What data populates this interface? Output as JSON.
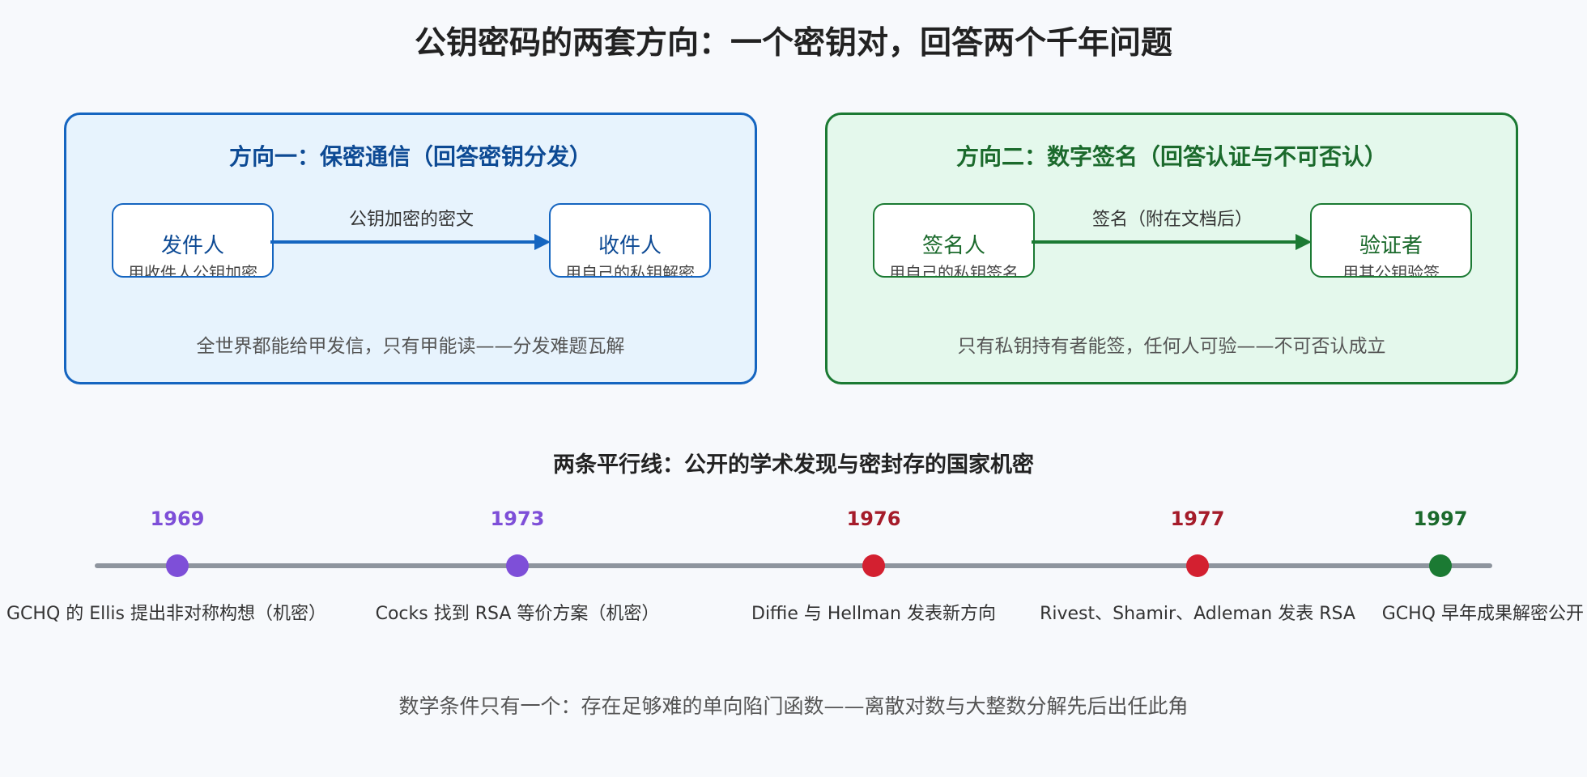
{
  "title": "公钥密码的两套方向：一个密钥对，回答两个千年问题",
  "colors": {
    "blue": "#1565c0",
    "green": "#1b7a33",
    "purple": "#7e4fd8",
    "red": "#d32030",
    "dark_green": "#1b7a33"
  },
  "panels": [
    {
      "title": "方向一：保密通信（回答密钥分发）",
      "left_node": {
        "name": "发件人",
        "sub": "用收件人公钥加密"
      },
      "edge_label": "公钥加密的密文",
      "right_node": {
        "name": "收件人",
        "sub": "用自己的私钥解密"
      },
      "footer": "全世界都能给甲发信，只有甲能读——分发难题瓦解"
    },
    {
      "title": "方向二：数字签名（回答认证与不可否认）",
      "left_node": {
        "name": "签名人",
        "sub": "用自己的私钥签名"
      },
      "edge_label": "签名（附在文档后）",
      "right_node": {
        "name": "验证者",
        "sub": "用其公钥验签"
      },
      "footer": "只有私钥持有者能签，任何人可验——不可否认成立"
    }
  ],
  "timeline": {
    "title": "两条平行线：公开的学术发现与密封存的国家机密",
    "events": [
      {
        "year": "1969",
        "text": "GCHQ 的 Ellis 提出非对称构想（机密）",
        "color": "#7e4fd8"
      },
      {
        "year": "1973",
        "text": "Cocks 找到 RSA 等价方案（机密）",
        "color": "#7e4fd8"
      },
      {
        "year": "1976",
        "text": "Diffie 与 Hellman 发表新方向",
        "color": "#d32030"
      },
      {
        "year": "1977",
        "text": "Rivest、Shamir、Adleman 发表 RSA",
        "color": "#d32030"
      },
      {
        "year": "1997",
        "text": "GCHQ 早年成果解密公开",
        "color": "#1b7a33"
      }
    ]
  },
  "footer": "数学条件只有一个：存在足够难的单向陷门函数——离散对数与大整数分解先后出任此角"
}
